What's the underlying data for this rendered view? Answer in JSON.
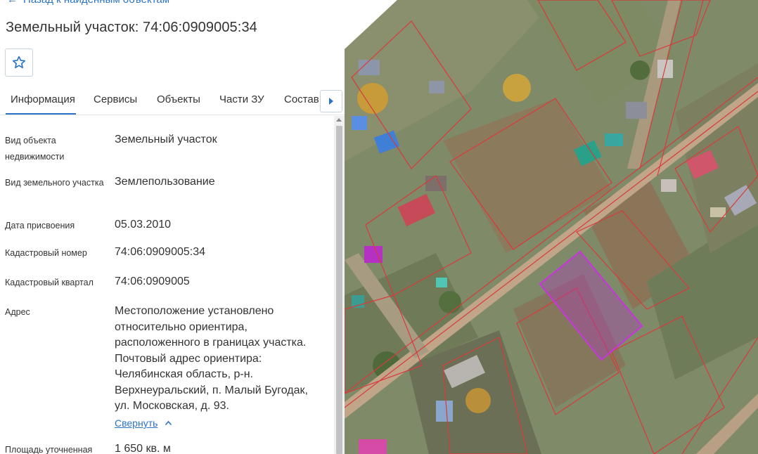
{
  "nav": {
    "back_label": "Назад к найденным объектам"
  },
  "header": {
    "title": "Земельный участок: 74:06:0909005:34"
  },
  "tabs": [
    {
      "label": "Информация"
    },
    {
      "label": "Сервисы"
    },
    {
      "label": "Объекты"
    },
    {
      "label": "Части ЗУ"
    },
    {
      "label": "Состав"
    }
  ],
  "info": {
    "rows": [
      {
        "label": "Вид объекта недвижимости",
        "value": "Земельный участок"
      },
      {
        "label": "Вид земельного участка",
        "value": "Землепользование"
      },
      {
        "label": "Дата присвоения",
        "value": "05.03.2010"
      },
      {
        "label": "Кадастровый номер",
        "value": "74:06:0909005:34"
      },
      {
        "label": "Кадастровый квартал",
        "value": "74:06:0909005"
      },
      {
        "label": "Адрес",
        "value": "Местоположение установлено относительно ориентира, расположенного в границах участка. Почтовый адрес ориентира: Челябинская область, р-н. Верхнеуральский, п. Малый Бугодак, ул. Московская, д. 93."
      },
      {
        "label": "Площадь уточненная",
        "value": "1 650 кв. м"
      }
    ],
    "collapse_label": "Свернуть"
  },
  "colors": {
    "accent": "#2b73c2",
    "parcel_highlight": "#b133c7",
    "parcel_border": "#d93a3a"
  },
  "icons": {
    "favorite": "star-outline-icon",
    "back": "arrow-left-icon",
    "tab_next": "caret-right-icon",
    "collapse": "chevron-up-icon"
  }
}
